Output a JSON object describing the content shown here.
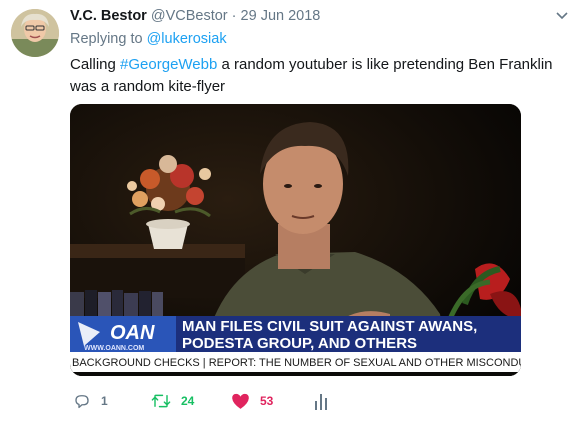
{
  "tweet": {
    "author_name": "V.C. Bestor",
    "author_handle": "@VCBestor",
    "separator": "·",
    "date": "29 Jun 2018",
    "reply_prefix": "Replying to",
    "reply_to": "@lukerosiak",
    "text_before": "Calling ",
    "hashtag": "#GeorgeWebb",
    "text_after": " a random youtuber is like pretending Ben Franklin was a random kite-flyer"
  },
  "media": {
    "network_logo": "OAN",
    "network_url": "WWW.OANN.COM",
    "headline_line1": "MAN FILES CIVIL SUIT AGAINST AWANS,",
    "headline_line2": "PODESTA GROUP, AND OTHERS",
    "ticker": "BACKGROUND CHECKS  |  REPORT: THE NUMBER OF SEXUAL AND OTHER MISCONDUCT VIC"
  },
  "actions": {
    "replies": "1",
    "retweets": "24",
    "likes": "53",
    "icons": [
      "reply-icon",
      "retweet-icon",
      "heart-icon",
      "analytics-icon"
    ],
    "retweet_color": "#17bf63",
    "like_color": "#e0245e"
  },
  "colors": {
    "link": "#1da1f2",
    "muted": "#657786",
    "headline_bg": "#1c2f7c",
    "logo_bg": "#2a55b8"
  }
}
